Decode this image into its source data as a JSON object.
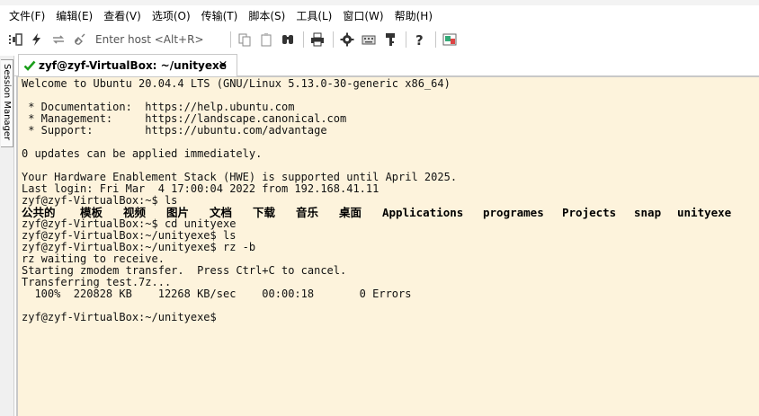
{
  "menu": [
    "文件(F)",
    "编辑(E)",
    "查看(V)",
    "选项(O)",
    "传输(T)",
    "脚本(S)",
    "工具(L)",
    "窗口(W)",
    "帮助(H)"
  ],
  "toolbar": {
    "host_placeholder": "Enter host <Alt+R>",
    "icons": [
      "connect-in-tab-icon",
      "quick-connect-icon",
      "reconnect-icon",
      "disconnect-icon",
      "copy-icon",
      "paste-icon",
      "find-icon",
      "print-icon",
      "settings-icon",
      "keymap-icon",
      "key-icon",
      "help-icon",
      "sftp-icon"
    ]
  },
  "session_manager": {
    "label": "Session Manager"
  },
  "tab": {
    "title": "zyf@zyf-VirtualBox: ~/unityexe",
    "close": "×",
    "status_color": "#1a9e1a"
  },
  "terminal": {
    "background": "#fdf3dc",
    "lines": [
      "Welcome to Ubuntu 20.04.4 LTS (GNU/Linux 5.13.0-30-generic x86_64)",
      "",
      " * Documentation:  https://help.ubuntu.com",
      " * Management:     https://landscape.canonical.com",
      " * Support:        https://ubuntu.com/advantage",
      "",
      "0 updates can be applied immediately.",
      "",
      "Your Hardware Enablement Stack (HWE) is supported until April 2025.",
      "Last login: Fri Mar  4 17:00:04 2022 from 192.168.41.11",
      "zyf@zyf-VirtualBox:~$ ls"
    ],
    "dir_listing": [
      "公共的",
      "模板",
      "视频",
      "图片",
      "文档",
      "下载",
      "音乐",
      "桌面",
      "Applications",
      "programes",
      "Projects",
      "snap",
      "unityexe"
    ],
    "lines_after": [
      "zyf@zyf-VirtualBox:~$ cd unityexe",
      "zyf@zyf-VirtualBox:~/unityexe$ ls",
      "zyf@zyf-VirtualBox:~/unityexe$ rz -b",
      "rz waiting to receive.",
      "Starting zmodem transfer.  Press Ctrl+C to cancel.",
      "Transferring test.7z...",
      "  100%  220828 KB    12268 KB/sec    00:00:18       0 Errors",
      "",
      "zyf@zyf-VirtualBox:~/unityexe$"
    ]
  }
}
